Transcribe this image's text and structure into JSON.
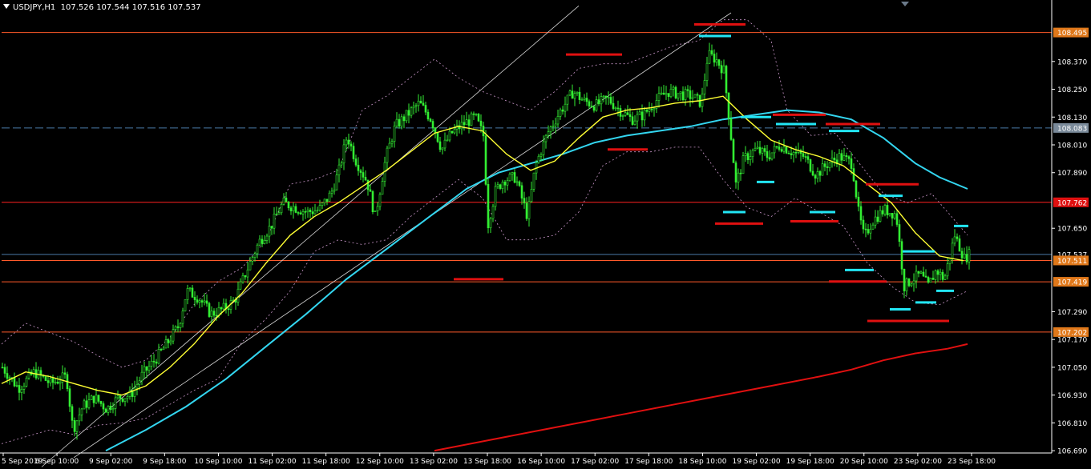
{
  "header": {
    "symbol": "USDJPY,H1",
    "ohlc": "107.526 107.544 107.516 107.537"
  },
  "colors": {
    "background": "#000000",
    "bull": "#33ee33",
    "bear": "#33ee33",
    "ema_fast": "#ffff33",
    "ema_mid": "#33d6f0",
    "ema_slow": "#e01010",
    "bands": "#cc99cc",
    "hline": "#ff5a2a",
    "hline_red": "#ff2020",
    "dashed": "#4a7aa8",
    "price_tag": "#e0781a",
    "grid_text": "#ffffff"
  },
  "chart_data": {
    "type": "candlestick",
    "symbol": "USDJPY",
    "timeframe": "H1",
    "ylim": [
      106.68,
      108.58
    ],
    "y_ticks": [
      "108.370",
      "108.250",
      "108.130",
      "108.010",
      "107.890",
      "107.650",
      "107.290",
      "107.170",
      "107.050",
      "106.930",
      "106.810",
      "106.690"
    ],
    "x_ticks": [
      "5 Sep 2019",
      "6 Sep 10:00",
      "9 Sep 02:00",
      "9 Sep 18:00",
      "10 Sep 10:00",
      "11 Sep 02:00",
      "11 Sep 18:00",
      "12 Sep 10:00",
      "13 Sep 02:00",
      "13 Sep 18:00",
      "16 Sep 10:00",
      "17 Sep 02:00",
      "17 Sep 18:00",
      "18 Sep 10:00",
      "19 Sep 02:00",
      "19 Sep 18:00",
      "20 Sep 10:00",
      "23 Sep 02:00",
      "23 Sep 18:00"
    ],
    "price_tags": [
      {
        "label": "108.495",
        "value": 108.495,
        "style": "orange"
      },
      {
        "label": "108.083",
        "value": 108.083,
        "style": "gray"
      },
      {
        "label": "107.762",
        "value": 107.762,
        "style": "red"
      },
      {
        "label": "107.537",
        "value": 107.537,
        "style": "plain"
      },
      {
        "label": "107.511",
        "value": 107.511,
        "style": "orange"
      },
      {
        "label": "107.419",
        "value": 107.419,
        "style": "orange"
      },
      {
        "label": "107.202",
        "value": 107.202,
        "style": "orange"
      }
    ],
    "horizontal_lines": [
      {
        "value": 108.495,
        "style": "solid",
        "color": "hline"
      },
      {
        "value": 108.083,
        "style": "dashed",
        "color": "dashed"
      },
      {
        "value": 107.762,
        "style": "solid",
        "color": "hline_red"
      },
      {
        "value": 107.537,
        "style": "solid",
        "color": "dashed"
      },
      {
        "value": 107.511,
        "style": "solid",
        "color": "hline"
      },
      {
        "value": 107.419,
        "style": "solid",
        "color": "hline"
      },
      {
        "value": 107.202,
        "style": "solid",
        "color": "hline"
      }
    ],
    "close_path": [
      [
        0,
        107.05
      ],
      [
        20,
        106.96
      ],
      [
        40,
        107.03
      ],
      [
        60,
        106.98
      ],
      [
        80,
        107.01
      ],
      [
        88,
        106.78
      ],
      [
        100,
        106.88
      ],
      [
        115,
        106.92
      ],
      [
        130,
        106.87
      ],
      [
        145,
        106.92
      ],
      [
        160,
        106.93
      ],
      [
        175,
        107.02
      ],
      [
        190,
        107.08
      ],
      [
        205,
        107.15
      ],
      [
        220,
        107.23
      ],
      [
        230,
        107.38
      ],
      [
        245,
        107.35
      ],
      [
        260,
        107.28
      ],
      [
        275,
        107.3
      ],
      [
        290,
        107.34
      ],
      [
        305,
        107.47
      ],
      [
        320,
        107.59
      ],
      [
        335,
        107.66
      ],
      [
        350,
        107.76
      ],
      [
        365,
        107.74
      ],
      [
        380,
        107.72
      ],
      [
        395,
        107.73
      ],
      [
        410,
        107.8
      ],
      [
        420,
        107.9
      ],
      [
        430,
        108.05
      ],
      [
        440,
        107.95
      ],
      [
        455,
        107.85
      ],
      [
        465,
        107.7
      ],
      [
        478,
        107.95
      ],
      [
        490,
        108.09
      ],
      [
        505,
        108.14
      ],
      [
        520,
        108.19
      ],
      [
        535,
        108.12
      ],
      [
        548,
        107.99
      ],
      [
        560,
        108.06
      ],
      [
        575,
        108.1
      ],
      [
        590,
        108.13
      ],
      [
        600,
        108.05
      ],
      [
        606,
        107.67
      ],
      [
        615,
        107.81
      ],
      [
        625,
        107.86
      ],
      [
        640,
        107.87
      ],
      [
        655,
        107.7
      ],
      [
        665,
        107.92
      ],
      [
        680,
        108.06
      ],
      [
        695,
        108.15
      ],
      [
        712,
        108.24
      ],
      [
        725,
        108.2
      ],
      [
        740,
        108.18
      ],
      [
        755,
        108.21
      ],
      [
        770,
        108.16
      ],
      [
        785,
        108.12
      ],
      [
        800,
        108.14
      ],
      [
        815,
        108.2
      ],
      [
        830,
        108.24
      ],
      [
        845,
        108.23
      ],
      [
        860,
        108.22
      ],
      [
        872,
        108.19
      ],
      [
        880,
        108.4
      ],
      [
        890,
        108.38
      ],
      [
        900,
        108.33
      ],
      [
        908,
        108.08
      ],
      [
        915,
        107.84
      ],
      [
        925,
        107.95
      ],
      [
        940,
        107.99
      ],
      [
        955,
        107.96
      ],
      [
        970,
        108.01
      ],
      [
        985,
        107.98
      ],
      [
        1000,
        107.96
      ],
      [
        1015,
        107.88
      ],
      [
        1030,
        107.93
      ],
      [
        1045,
        107.96
      ],
      [
        1060,
        107.93
      ],
      [
        1068,
        107.72
      ],
      [
        1075,
        107.61
      ],
      [
        1085,
        107.68
      ],
      [
        1100,
        107.73
      ],
      [
        1115,
        107.71
      ],
      [
        1125,
        107.4
      ],
      [
        1135,
        107.43
      ],
      [
        1145,
        107.45
      ],
      [
        1155,
        107.4
      ],
      [
        1165,
        107.47
      ],
      [
        1175,
        107.43
      ],
      [
        1188,
        107.62
      ],
      [
        1200,
        107.52
      ],
      [
        1207,
        107.54
      ]
    ],
    "ema_fast": [
      [
        0,
        106.98
      ],
      [
        30,
        107.03
      ],
      [
        60,
        107.01
      ],
      [
        90,
        106.98
      ],
      [
        120,
        106.95
      ],
      [
        150,
        106.93
      ],
      [
        180,
        106.97
      ],
      [
        210,
        107.05
      ],
      [
        240,
        107.15
      ],
      [
        270,
        107.27
      ],
      [
        300,
        107.37
      ],
      [
        330,
        107.5
      ],
      [
        360,
        107.62
      ],
      [
        390,
        107.7
      ],
      [
        420,
        107.76
      ],
      [
        450,
        107.83
      ],
      [
        480,
        107.9
      ],
      [
        510,
        107.98
      ],
      [
        540,
        108.06
      ],
      [
        570,
        108.09
      ],
      [
        600,
        108.07
      ],
      [
        630,
        107.97
      ],
      [
        660,
        107.9
      ],
      [
        690,
        107.94
      ],
      [
        720,
        108.04
      ],
      [
        750,
        108.13
      ],
      [
        780,
        108.16
      ],
      [
        810,
        108.17
      ],
      [
        840,
        108.19
      ],
      [
        870,
        108.2
      ],
      [
        900,
        108.22
      ],
      [
        930,
        108.12
      ],
      [
        960,
        108.03
      ],
      [
        990,
        107.99
      ],
      [
        1020,
        107.96
      ],
      [
        1050,
        107.92
      ],
      [
        1080,
        107.84
      ],
      [
        1110,
        107.76
      ],
      [
        1140,
        107.63
      ],
      [
        1170,
        107.53
      ],
      [
        1200,
        107.51
      ]
    ],
    "ema_mid": [
      [
        130,
        106.69
      ],
      [
        180,
        106.78
      ],
      [
        230,
        106.88
      ],
      [
        280,
        107.0
      ],
      [
        330,
        107.14
      ],
      [
        380,
        107.28
      ],
      [
        430,
        107.43
      ],
      [
        480,
        107.56
      ],
      [
        530,
        107.69
      ],
      [
        580,
        107.82
      ],
      [
        620,
        107.89
      ],
      [
        660,
        107.93
      ],
      [
        700,
        107.97
      ],
      [
        740,
        108.02
      ],
      [
        780,
        108.05
      ],
      [
        820,
        108.07
      ],
      [
        860,
        108.09
      ],
      [
        900,
        108.12
      ],
      [
        940,
        108.14
      ],
      [
        980,
        108.16
      ],
      [
        1020,
        108.15
      ],
      [
        1060,
        108.12
      ],
      [
        1100,
        108.04
      ],
      [
        1140,
        107.93
      ],
      [
        1170,
        107.87
      ],
      [
        1205,
        107.82
      ]
    ],
    "ema_slow": [
      [
        540,
        106.69
      ],
      [
        600,
        106.73
      ],
      [
        660,
        106.77
      ],
      [
        720,
        106.81
      ],
      [
        780,
        106.85
      ],
      [
        840,
        106.89
      ],
      [
        900,
        106.93
      ],
      [
        960,
        106.97
      ],
      [
        1020,
        107.01
      ],
      [
        1060,
        107.04
      ],
      [
        1100,
        107.08
      ],
      [
        1140,
        107.11
      ],
      [
        1180,
        107.13
      ],
      [
        1205,
        107.15
      ]
    ],
    "band_upper": [
      [
        0,
        107.15
      ],
      [
        30,
        107.24
      ],
      [
        60,
        107.2
      ],
      [
        90,
        107.16
      ],
      [
        120,
        107.1
      ],
      [
        150,
        107.05
      ],
      [
        180,
        107.08
      ],
      [
        210,
        107.18
      ],
      [
        240,
        107.32
      ],
      [
        270,
        107.42
      ],
      [
        300,
        107.48
      ],
      [
        330,
        107.6
      ],
      [
        360,
        107.84
      ],
      [
        390,
        107.86
      ],
      [
        420,
        107.9
      ],
      [
        450,
        108.16
      ],
      [
        480,
        108.22
      ],
      [
        510,
        108.3
      ],
      [
        540,
        108.38
      ],
      [
        570,
        108.3
      ],
      [
        600,
        108.24
      ],
      [
        630,
        108.2
      ],
      [
        660,
        108.16
      ],
      [
        690,
        108.24
      ],
      [
        720,
        108.34
      ],
      [
        750,
        108.36
      ],
      [
        780,
        108.36
      ],
      [
        810,
        108.4
      ],
      [
        840,
        108.44
      ],
      [
        870,
        108.46
      ],
      [
        900,
        108.55
      ],
      [
        930,
        108.55
      ],
      [
        960,
        108.46
      ],
      [
        980,
        108.16
      ],
      [
        1010,
        108.05
      ],
      [
        1040,
        108.06
      ],
      [
        1070,
        107.93
      ],
      [
        1100,
        107.8
      ],
      [
        1130,
        107.76
      ],
      [
        1160,
        107.8
      ],
      [
        1180,
        107.72
      ],
      [
        1205,
        107.62
      ]
    ],
    "band_lower": [
      [
        0,
        106.72
      ],
      [
        30,
        106.75
      ],
      [
        60,
        106.78
      ],
      [
        90,
        106.76
      ],
      [
        120,
        106.8
      ],
      [
        150,
        106.81
      ],
      [
        180,
        106.83
      ],
      [
        210,
        106.89
      ],
      [
        240,
        106.95
      ],
      [
        270,
        107.0
      ],
      [
        300,
        107.16
      ],
      [
        330,
        107.26
      ],
      [
        360,
        107.38
      ],
      [
        390,
        107.55
      ],
      [
        420,
        107.6
      ],
      [
        450,
        107.58
      ],
      [
        480,
        107.6
      ],
      [
        510,
        107.7
      ],
      [
        540,
        107.78
      ],
      [
        570,
        107.86
      ],
      [
        600,
        107.78
      ],
      [
        630,
        107.6
      ],
      [
        660,
        107.6
      ],
      [
        690,
        107.62
      ],
      [
        720,
        107.72
      ],
      [
        750,
        107.92
      ],
      [
        780,
        107.98
      ],
      [
        810,
        107.98
      ],
      [
        840,
        108.0
      ],
      [
        870,
        108.0
      ],
      [
        900,
        107.86
      ],
      [
        930,
        107.74
      ],
      [
        960,
        107.7
      ],
      [
        990,
        107.78
      ],
      [
        1020,
        107.72
      ],
      [
        1050,
        107.66
      ],
      [
        1080,
        107.5
      ],
      [
        1110,
        107.4
      ],
      [
        1140,
        107.33
      ],
      [
        1170,
        107.32
      ],
      [
        1205,
        107.38
      ]
    ],
    "trendlines": [
      {
        "from": [
          50,
          106.62
        ],
        "to": [
          720,
          108.61
        ]
      },
      {
        "from": [
          90,
          106.66
        ],
        "to": [
          910,
          108.58
        ]
      }
    ],
    "levels": [
      {
        "x1": 864,
        "x2": 928,
        "value": 108.53,
        "color": "red"
      },
      {
        "x1": 704,
        "x2": 774,
        "value": 108.4,
        "color": "red"
      },
      {
        "x1": 756,
        "x2": 806,
        "value": 107.99,
        "color": "red"
      },
      {
        "x1": 564,
        "x2": 626,
        "value": 107.43,
        "color": "red"
      },
      {
        "x1": 962,
        "x2": 1028,
        "value": 108.14,
        "color": "red"
      },
      {
        "x1": 1028,
        "x2": 1096,
        "value": 108.1,
        "color": "red"
      },
      {
        "x1": 1078,
        "x2": 1144,
        "value": 107.84,
        "color": "red"
      },
      {
        "x1": 890,
        "x2": 950,
        "value": 107.67,
        "color": "red"
      },
      {
        "x1": 984,
        "x2": 1044,
        "value": 107.68,
        "color": "red"
      },
      {
        "x1": 1032,
        "x2": 1104,
        "value": 107.42,
        "color": "red"
      },
      {
        "x1": 1080,
        "x2": 1182,
        "value": 107.25,
        "color": "red"
      },
      {
        "x1": 870,
        "x2": 910,
        "value": 108.48,
        "color": "cyan"
      },
      {
        "x1": 922,
        "x2": 960,
        "value": 108.13,
        "color": "cyan"
      },
      {
        "x1": 966,
        "x2": 1016,
        "value": 108.1,
        "color": "cyan"
      },
      {
        "x1": 1032,
        "x2": 1070,
        "value": 108.07,
        "color": "cyan"
      },
      {
        "x1": 942,
        "x2": 964,
        "value": 107.85,
        "color": "cyan"
      },
      {
        "x1": 900,
        "x2": 928,
        "value": 107.72,
        "color": "cyan"
      },
      {
        "x1": 1008,
        "x2": 1040,
        "value": 107.72,
        "color": "cyan"
      },
      {
        "x1": 1094,
        "x2": 1124,
        "value": 107.79,
        "color": "cyan"
      },
      {
        "x1": 1052,
        "x2": 1088,
        "value": 107.47,
        "color": "cyan"
      },
      {
        "x1": 1124,
        "x2": 1164,
        "value": 107.55,
        "color": "cyan"
      },
      {
        "x1": 1188,
        "x2": 1206,
        "value": 107.66,
        "color": "cyan"
      },
      {
        "x1": 1166,
        "x2": 1188,
        "value": 107.38,
        "color": "cyan"
      },
      {
        "x1": 1140,
        "x2": 1166,
        "value": 107.33,
        "color": "cyan"
      },
      {
        "x1": 1108,
        "x2": 1134,
        "value": 107.3,
        "color": "cyan"
      }
    ]
  }
}
